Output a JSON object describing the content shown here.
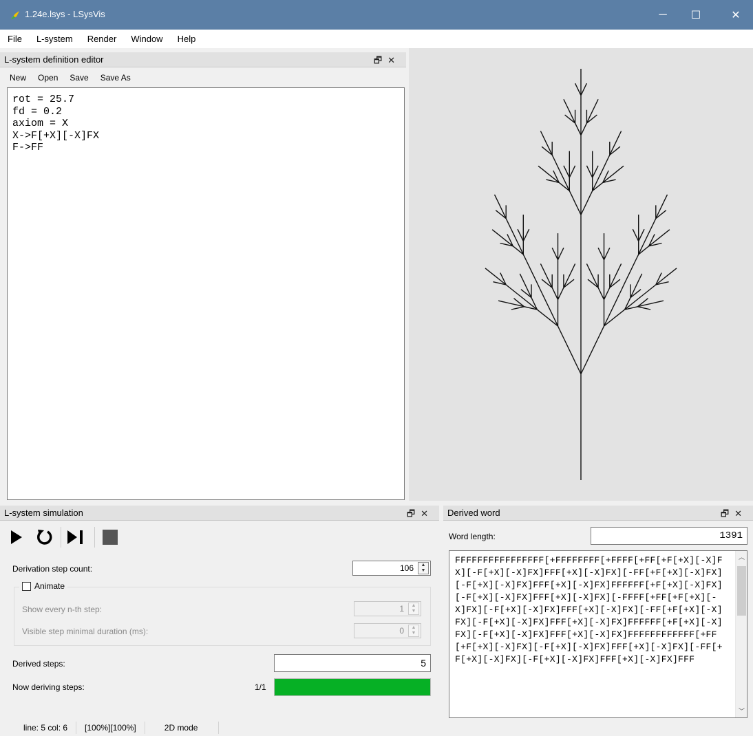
{
  "window": {
    "title": "1.24e.lsys - LSysVis",
    "minimize": "─",
    "maximize": "☐",
    "close": "✕"
  },
  "menu": [
    "File",
    "L-system",
    "Render",
    "Window",
    "Help"
  ],
  "editor_panel": {
    "title": "L-system definition editor",
    "toolbar": [
      "New",
      "Open",
      "Save",
      "Save As"
    ],
    "content": "rot = 25.7\nfd = 0.2\naxiom = X\nX->F[+X][-X]FX\nF->FF"
  },
  "simulation_panel": {
    "title": "L-system simulation",
    "derivation_step_label": "Derivation step count:",
    "derivation_step_value": "106",
    "animate_label": "Animate",
    "animate_checked": false,
    "show_nth_label": "Show every n-th step:",
    "show_nth_value": "1",
    "min_duration_label": "Visible step minimal duration (ms):",
    "min_duration_value": "0",
    "derived_steps_label": "Derived steps:",
    "derived_steps_value": "5",
    "now_deriving_label": "Now deriving steps:",
    "now_deriving_value": "1/1",
    "progress_fraction": 1.0,
    "progress_color": "#06b025"
  },
  "derived_word_panel": {
    "title": "Derived word",
    "word_length_label": "Word length:",
    "word_length_value": "1391",
    "word": "FFFFFFFFFFFFFFFF[+FFFFFFFF[+FFFF[+FF[+F[+X][-X]FX][-F[+X][-X]FX]FFF[+X][-X]FX][-FF[+F[+X][-X]FX][-F[+X][-X]FX]FFF[+X][-X]FX]FFFFFF[+F[+X][-X]FX][-F[+X][-X]FX]FFF[+X][-X]FX][-FFFF[+FF[+F[+X][-X]FX][-F[+X][-X]FX]FFF[+X][-X]FX][-FF[+F[+X][-X]FX][-F[+X][-X]FX]FFF[+X][-X]FX]FFFFFF[+F[+X][-X]FX][-F[+X][-X]FX]FFF[+X][-X]FX]FFFFFFFFFFFF[+FF[+F[+X][-X]FX][-F[+X][-X]FX]FFF[+X][-X]FX][-FF[+F[+X][-X]FX][-F[+X][-X]FX]FFF[+X][-X]FX]FFF"
  },
  "status": {
    "position": "line: 5 col: 6",
    "zoom": "[100%][100%]",
    "mode": "2D mode"
  }
}
